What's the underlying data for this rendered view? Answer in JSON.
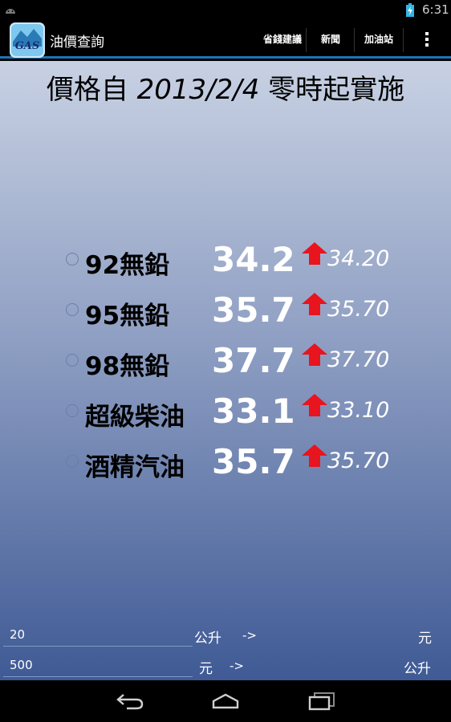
{
  "status_bar": {
    "time": "6:31"
  },
  "app": {
    "title": "油價查詢"
  },
  "actions": [
    {
      "label": "省錢建議"
    },
    {
      "label": "新聞"
    },
    {
      "label": "加油站"
    }
  ],
  "effective": {
    "prefix": "價格自 ",
    "date": "2013/2/4",
    "suffix": " 零時起實施"
  },
  "fuels": [
    {
      "name": "92無鉛",
      "price": "34.2",
      "previous": "34.20",
      "trend": "up"
    },
    {
      "name": "95無鉛",
      "price": "35.7",
      "previous": "35.70",
      "trend": "up"
    },
    {
      "name": "98無鉛",
      "price": "37.7",
      "previous": "37.70",
      "trend": "up"
    },
    {
      "name": "超級柴油",
      "price": "33.1",
      "previous": "33.10",
      "trend": "up"
    },
    {
      "name": "酒精汽油",
      "price": "35.7",
      "previous": "35.70",
      "trend": "up"
    }
  ],
  "calculator": {
    "liters_value": "20",
    "liters_unit": "公升",
    "arrow": "->",
    "liters_result_unit": "元",
    "money_value": "500",
    "money_unit": "元",
    "money_result_unit": "公升"
  },
  "colors": {
    "accent": "#1e73b5",
    "arrow": "#e8141e",
    "price_text": "#ffffff"
  }
}
